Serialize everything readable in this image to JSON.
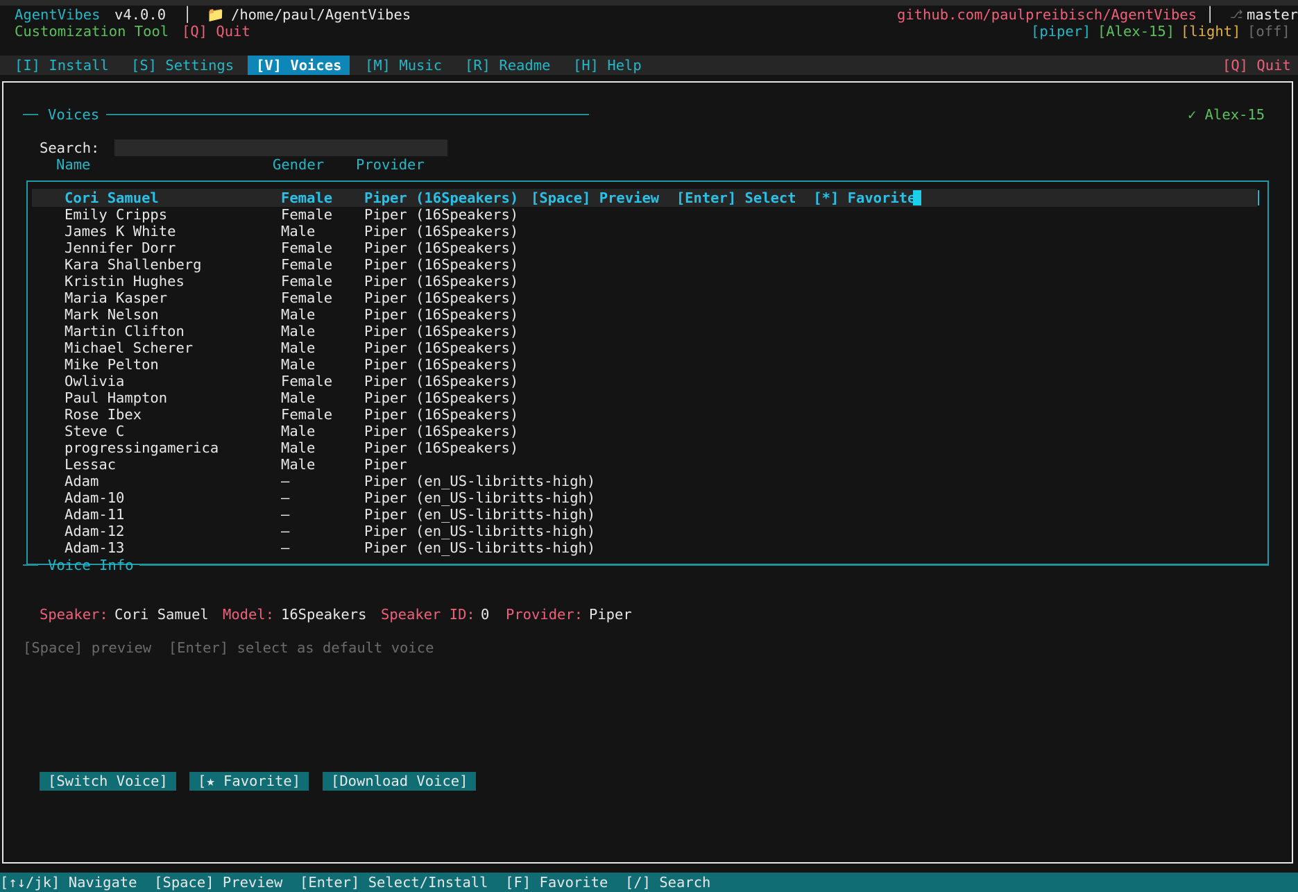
{
  "header": {
    "app_name": "AgentVibes",
    "version": "v4.0.0",
    "separator": "│",
    "folder_icon": "📁",
    "path": "/home/paul/AgentVibes",
    "subtitle": "Customization Tool",
    "quit": "[Q] Quit",
    "repo": "github.com/paulpreibisch/AgentVibes",
    "branch_icon": "⎇",
    "branch": "master",
    "status_tags": {
      "provider": "[piper]",
      "voice": "[Alex-15]",
      "theme": "[light]",
      "off": "[off]"
    }
  },
  "tabs": [
    {
      "label": "[I] Install"
    },
    {
      "label": "[S] Settings"
    },
    {
      "label": "[V] Voices"
    },
    {
      "label": "[M] Music"
    },
    {
      "label": "[R] Readme"
    },
    {
      "label": "[H] Help"
    }
  ],
  "tab_quit": "[Q] Quit",
  "active_tab": "[V] Voices",
  "voices_panel": {
    "title": "Voices",
    "current_voice": "✓ Alex-15",
    "search_label": "Search:",
    "search_value": "",
    "columns": {
      "name": "Name",
      "gender": "Gender",
      "provider": "Provider"
    },
    "selected_hint": "[Space] Preview  [Enter] Select  [*] Favorite",
    "rows": [
      {
        "name": "Cori Samuel",
        "gender": "Female",
        "provider": "Piper (16Speakers)"
      },
      {
        "name": "Emily Cripps",
        "gender": "Female",
        "provider": "Piper (16Speakers)"
      },
      {
        "name": "James K White",
        "gender": "Male",
        "provider": "Piper (16Speakers)"
      },
      {
        "name": "Jennifer Dorr",
        "gender": "Female",
        "provider": "Piper (16Speakers)"
      },
      {
        "name": "Kara Shallenberg",
        "gender": "Female",
        "provider": "Piper (16Speakers)"
      },
      {
        "name": "Kristin Hughes",
        "gender": "Female",
        "provider": "Piper (16Speakers)"
      },
      {
        "name": "Maria Kasper",
        "gender": "Female",
        "provider": "Piper (16Speakers)"
      },
      {
        "name": "Mark Nelson",
        "gender": "Male",
        "provider": "Piper (16Speakers)"
      },
      {
        "name": "Martin Clifton",
        "gender": "Male",
        "provider": "Piper (16Speakers)"
      },
      {
        "name": "Michael Scherer",
        "gender": "Male",
        "provider": "Piper (16Speakers)"
      },
      {
        "name": "Mike Pelton",
        "gender": "Male",
        "provider": "Piper (16Speakers)"
      },
      {
        "name": "Owlivia",
        "gender": "Female",
        "provider": "Piper (16Speakers)"
      },
      {
        "name": "Paul Hampton",
        "gender": "Male",
        "provider": "Piper (16Speakers)"
      },
      {
        "name": "Rose Ibex",
        "gender": "Female",
        "provider": "Piper (16Speakers)"
      },
      {
        "name": "Steve C",
        "gender": "Male",
        "provider": "Piper (16Speakers)"
      },
      {
        "name": "progressingamerica",
        "gender": "Male",
        "provider": "Piper (16Speakers)"
      },
      {
        "name": "Lessac",
        "gender": "Male",
        "provider": "Piper"
      },
      {
        "name": "Adam",
        "gender": "—",
        "provider": "Piper (en_US-libritts-high)"
      },
      {
        "name": "Adam-10",
        "gender": "—",
        "provider": "Piper (en_US-libritts-high)"
      },
      {
        "name": "Adam-11",
        "gender": "—",
        "provider": "Piper (en_US-libritts-high)"
      },
      {
        "name": "Adam-12",
        "gender": "—",
        "provider": "Piper (en_US-libritts-high)"
      },
      {
        "name": "Adam-13",
        "gender": "—",
        "provider": "Piper (en_US-libritts-high)"
      }
    ]
  },
  "voice_info": {
    "title": "Voice Info",
    "speaker_label": "Speaker:",
    "speaker": "Cori Samuel",
    "model_label": "Model:",
    "model": "16Speakers",
    "speaker_id_label": "Speaker ID:",
    "speaker_id": "0",
    "provider_label": "Provider:",
    "provider": "Piper",
    "hint": "[Space] preview  [Enter] select as default voice"
  },
  "buttons": {
    "switch_voice": "[Switch Voice]",
    "favorite": "[★ Favorite]",
    "download_voice": "[Download Voice]"
  },
  "statusbar": "[↑↓/jk] Navigate  [Space] Preview  [Enter] Select/Install  [F] Favorite  [/] Search",
  "colors": {
    "accent": "#22b8c8",
    "active_tab": "#0f86b8",
    "button": "#0f6d73",
    "label": "#f0607a",
    "good": "#5cc05c"
  }
}
